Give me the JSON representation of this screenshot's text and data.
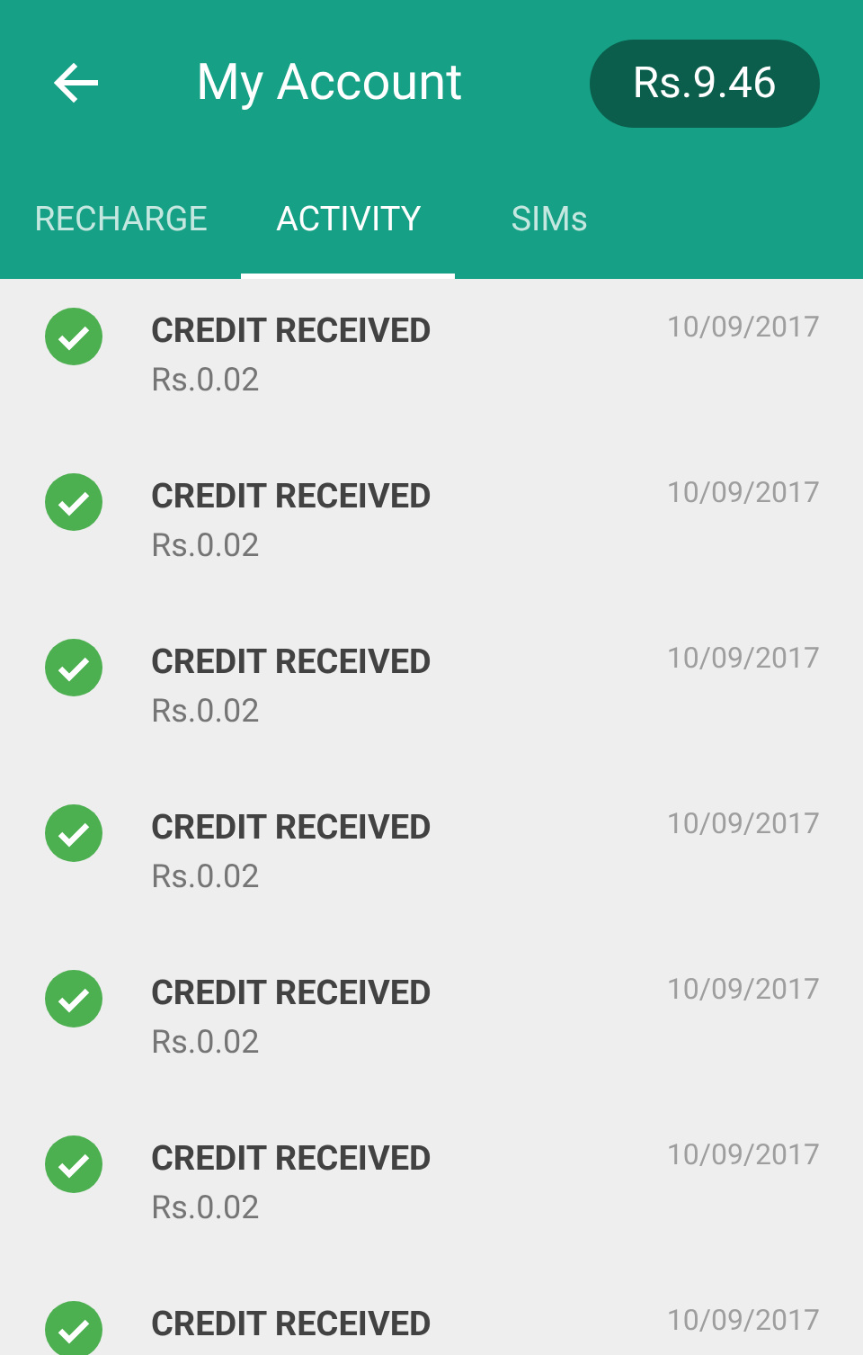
{
  "header": {
    "title": "My Account",
    "balance": "Rs.9.46"
  },
  "tabs": [
    {
      "label": "RECHARGE",
      "selected": false
    },
    {
      "label": "ACTIVITY",
      "selected": true
    },
    {
      "label": "SIMs",
      "selected": false
    }
  ],
  "activity": [
    {
      "title": "CREDIT RECEIVED",
      "amount": "Rs.0.02",
      "date": "10/09/2017"
    },
    {
      "title": "CREDIT RECEIVED",
      "amount": "Rs.0.02",
      "date": "10/09/2017"
    },
    {
      "title": "CREDIT RECEIVED",
      "amount": "Rs.0.02",
      "date": "10/09/2017"
    },
    {
      "title": "CREDIT RECEIVED",
      "amount": "Rs.0.02",
      "date": "10/09/2017"
    },
    {
      "title": "CREDIT RECEIVED",
      "amount": "Rs.0.02",
      "date": "10/09/2017"
    },
    {
      "title": "CREDIT RECEIVED",
      "amount": "Rs.0.02",
      "date": "10/09/2017"
    },
    {
      "title": "CREDIT RECEIVED",
      "date": "10/09/2017"
    }
  ]
}
